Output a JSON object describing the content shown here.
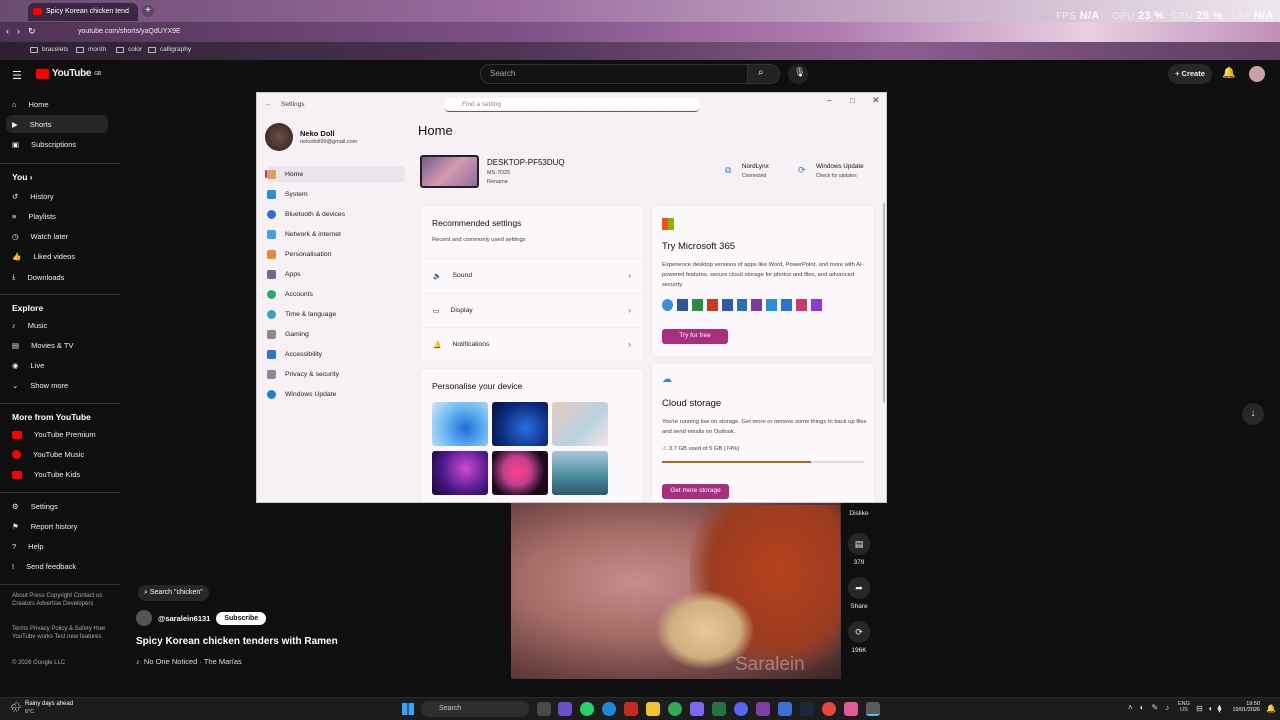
{
  "browser": {
    "tab_title": "Spicy Korean chicken tend",
    "url": "youtube.com/shorts/yaQdUYX9E",
    "bookmarks": [
      "bracelets",
      "month",
      "color",
      "calligraphy"
    ],
    "overlay": [
      {
        "label": "FPS",
        "value": "N/A"
      },
      {
        "label": "GPU",
        "value": "23 %"
      },
      {
        "label": "CPU",
        "value": "25 %"
      },
      {
        "label": "LAT",
        "value": "N/A"
      }
    ]
  },
  "youtube": {
    "logo": "YouTube",
    "region": "GB",
    "search_placeholder": "Search",
    "create_label": "Create",
    "sidebar": {
      "main": [
        "Home",
        "Shorts",
        "Subscriptions"
      ],
      "you_header": "You",
      "you": [
        "History",
        "Playlists",
        "Watch later",
        "Liked videos",
        "Downloads"
      ],
      "explore_header": "Explore",
      "explore": [
        "Music",
        "Movies & TV",
        "Live",
        "Show more"
      ],
      "more_header": "More from YouTube",
      "more": [
        "YouTube Premium",
        "YouTube Music",
        "YouTube Kids"
      ],
      "bottom": [
        "Settings",
        "Report history",
        "Help",
        "Send feedback"
      ],
      "footer1": "About  Press  Copyright  Contact us  Creators  Advertise  Developers",
      "footer2": "Terms  Privacy  Policy & Safety  How YouTube works  Test new features",
      "copyright": "© 2026 Google LLC"
    },
    "short": {
      "search_chip": "Search \"chicken\"",
      "channel": "@saralein6131",
      "subscribe": "Subscribe",
      "title": "Spicy Korean chicken tenders with Ramen",
      "music": "No One Noticed · The Marías",
      "watermark": "Saralein",
      "actions": [
        {
          "label": "Dislike",
          "icon": "thumb-down-icon"
        },
        {
          "label": "379",
          "icon": "comment-icon"
        },
        {
          "label": "Share",
          "icon": "share-icon"
        },
        {
          "label": "196K",
          "icon": "remix-icon"
        }
      ]
    }
  },
  "settings": {
    "title": "Settings",
    "search_placeholder": "Find a setting",
    "user_name": "Neko Doll",
    "user_email": "nekodoll99@gmail.com",
    "nav": [
      "Home",
      "System",
      "Bluetooth & devices",
      "Network & internet",
      "Personalisation",
      "Apps",
      "Accounts",
      "Time & language",
      "Gaming",
      "Accessibility",
      "Privacy & security",
      "Windows Update"
    ],
    "page_title": "Home",
    "device_name": "DESKTOP-PF53DUQ",
    "device_model": "MS-7D25",
    "rename": "Rename",
    "status": [
      {
        "title": "NordLynx",
        "sub": "Connected"
      },
      {
        "title": "Windows Update",
        "sub": "Check for updates"
      }
    ],
    "recommended": {
      "title": "Recommended settings",
      "subtitle": "Recent and commonly used settings",
      "rows": [
        "Sound",
        "Display",
        "Notifications"
      ]
    },
    "personalise_title": "Personalise your device",
    "m365": {
      "title": "Try Microsoft 365",
      "body": "Experience desktop versions of apps like Word, PowerPoint, and more with AI-powered features, secure cloud storage for photos and files, and advanced security.",
      "button": "Try for free"
    },
    "cloud": {
      "title": "Cloud storage",
      "body": "You're running low on storage. Get more or remove some things to back up files and send emails on Outlook.",
      "usage": "3.7 GB used of 5 GB (74%)",
      "fraction": 0.74,
      "button": "Get more storage"
    }
  },
  "taskbar": {
    "weather": "Rainy days ahead",
    "temp": "6°C",
    "search": "Search",
    "lang1": "ENG",
    "lang2": "US",
    "time": "19:50",
    "date": "19/01/2026"
  }
}
